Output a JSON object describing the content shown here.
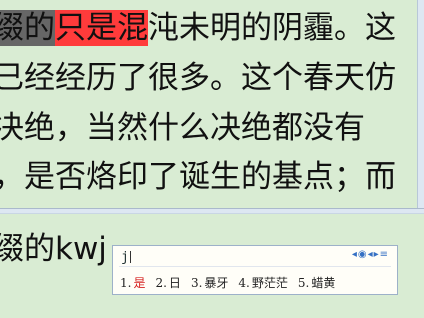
{
  "document": {
    "lines": [
      {
        "before": "",
        "hl_gray": "缀的",
        "hl_red": "只是混",
        "after": "沌未明的阴霾。这"
      },
      {
        "text": "已经经历了很多。这个春天仿"
      },
      {
        "text": "决绝，当然什么决绝都没有"
      },
      {
        "text": "，是否烙印了诞生的基点；而"
      }
    ]
  },
  "input": {
    "typed": "缀的",
    "composing": "kwj"
  },
  "ime": {
    "composition": "j",
    "icons": "◂◉◂▸≡",
    "candidates": [
      {
        "num": "1.",
        "word": "是"
      },
      {
        "num": "2.",
        "word": "日"
      },
      {
        "num": "3.",
        "word": "暴牙"
      },
      {
        "num": "4.",
        "word": "野茫茫"
      },
      {
        "num": "5.",
        "word": "蜡黄"
      }
    ]
  }
}
